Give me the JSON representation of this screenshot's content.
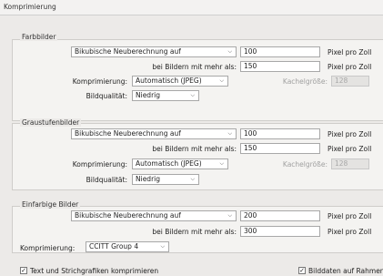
{
  "header": {
    "title": "Komprimierung"
  },
  "color": {
    "title": "Farbbilder",
    "resample": "Bikubische Neuberechnung auf",
    "resample_value": "100",
    "unit1": "Pixel pro Zoll",
    "above_label": "bei Bildern mit mehr als:",
    "above_value": "150",
    "unit2": "Pixel pro Zoll",
    "compression_label": "Komprimierung:",
    "compression_value": "Automatisch (JPEG)",
    "tile_label": "Kachelgröße:",
    "tile_value": "128",
    "quality_label": "Bildqualität:",
    "quality_value": "Niedrig"
  },
  "gray": {
    "title": "Graustufenbilder",
    "resample": "Bikubische Neuberechnung auf",
    "resample_value": "100",
    "unit1": "Pixel pro Zoll",
    "above_label": "bei Bildern mit mehr als:",
    "above_value": "150",
    "unit2": "Pixel pro Zoll",
    "compression_label": "Komprimierung:",
    "compression_value": "Automatisch (JPEG)",
    "tile_label": "Kachelgröße:",
    "tile_value": "128",
    "quality_label": "Bildqualität:",
    "quality_value": "Niedrig"
  },
  "mono": {
    "title": "Einfarbige Bilder",
    "resample": "Bikubische Neuberechnung auf",
    "resample_value": "200",
    "unit1": "Pixel pro Zoll",
    "above_label": "bei Bildern mit mehr als:",
    "above_value": "300",
    "unit2": "Pixel pro Zoll",
    "compression_label": "Komprimierung:",
    "compression_value": "CCITT Group 4"
  },
  "footer": {
    "text_compress": "Text und Strichgrafiken komprimieren",
    "crop": "Bilddaten auf Rahmen"
  }
}
